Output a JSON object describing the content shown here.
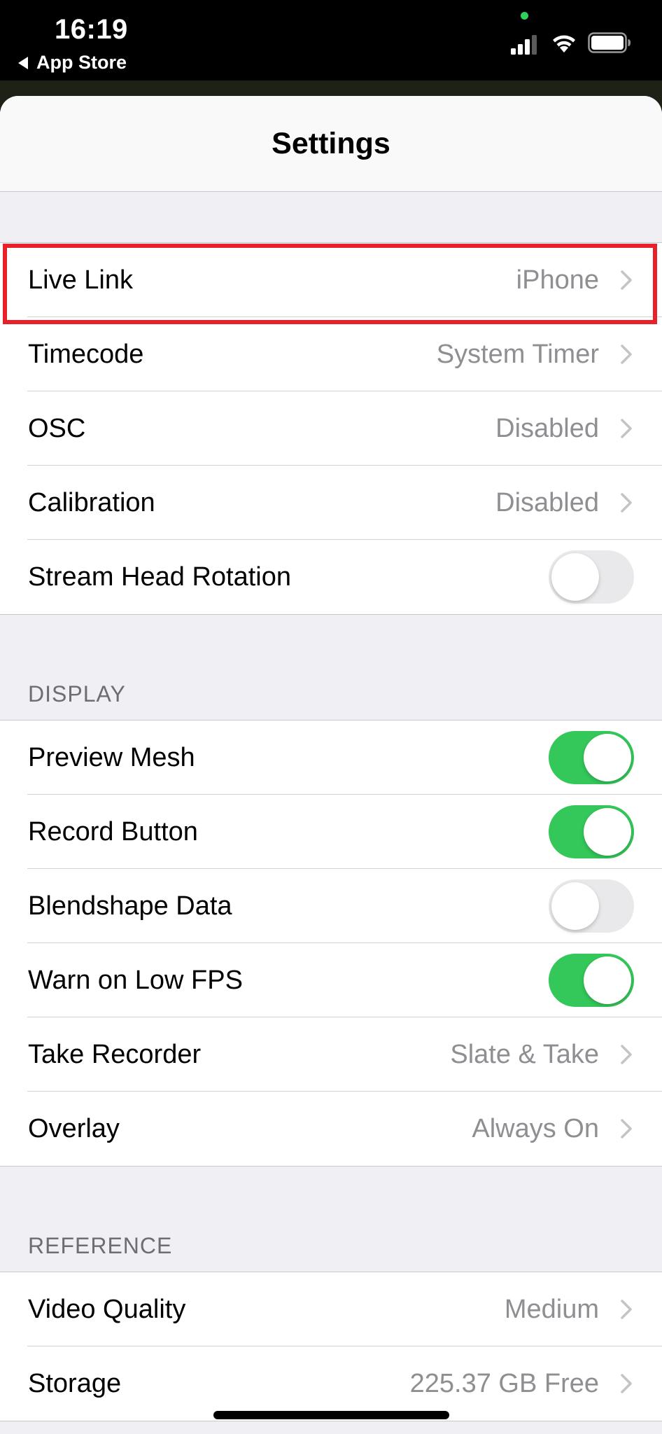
{
  "status_bar": {
    "time": "16:19",
    "back_label": "App Store"
  },
  "nav": {
    "title": "Settings"
  },
  "colors": {
    "toggle_on": "#34c759",
    "toggle_off": "#e9e9eb",
    "highlight": "#e8202a",
    "secondary_text": "#8e8e93"
  },
  "sections": {
    "general": {
      "rows": [
        {
          "label": "Live Link",
          "value": "iPhone",
          "type": "disclosure"
        },
        {
          "label": "Timecode",
          "value": "System Timer",
          "type": "disclosure"
        },
        {
          "label": "OSC",
          "value": "Disabled",
          "type": "disclosure"
        },
        {
          "label": "Calibration",
          "value": "Disabled",
          "type": "disclosure"
        },
        {
          "label": "Stream Head Rotation",
          "type": "toggle",
          "on": false
        }
      ]
    },
    "display": {
      "header": "DISPLAY",
      "rows": [
        {
          "label": "Preview Mesh",
          "type": "toggle",
          "on": true
        },
        {
          "label": "Record Button",
          "type": "toggle",
          "on": true
        },
        {
          "label": "Blendshape Data",
          "type": "toggle",
          "on": false
        },
        {
          "label": "Warn on Low FPS",
          "type": "toggle",
          "on": true
        },
        {
          "label": "Take Recorder",
          "value": "Slate & Take",
          "type": "disclosure"
        },
        {
          "label": "Overlay",
          "value": "Always On",
          "type": "disclosure"
        }
      ]
    },
    "reference": {
      "header": "REFERENCE",
      "rows": [
        {
          "label": "Video Quality",
          "value": "Medium",
          "type": "disclosure"
        },
        {
          "label": "Storage",
          "value": "225.37 GB Free",
          "type": "disclosure"
        }
      ]
    }
  }
}
